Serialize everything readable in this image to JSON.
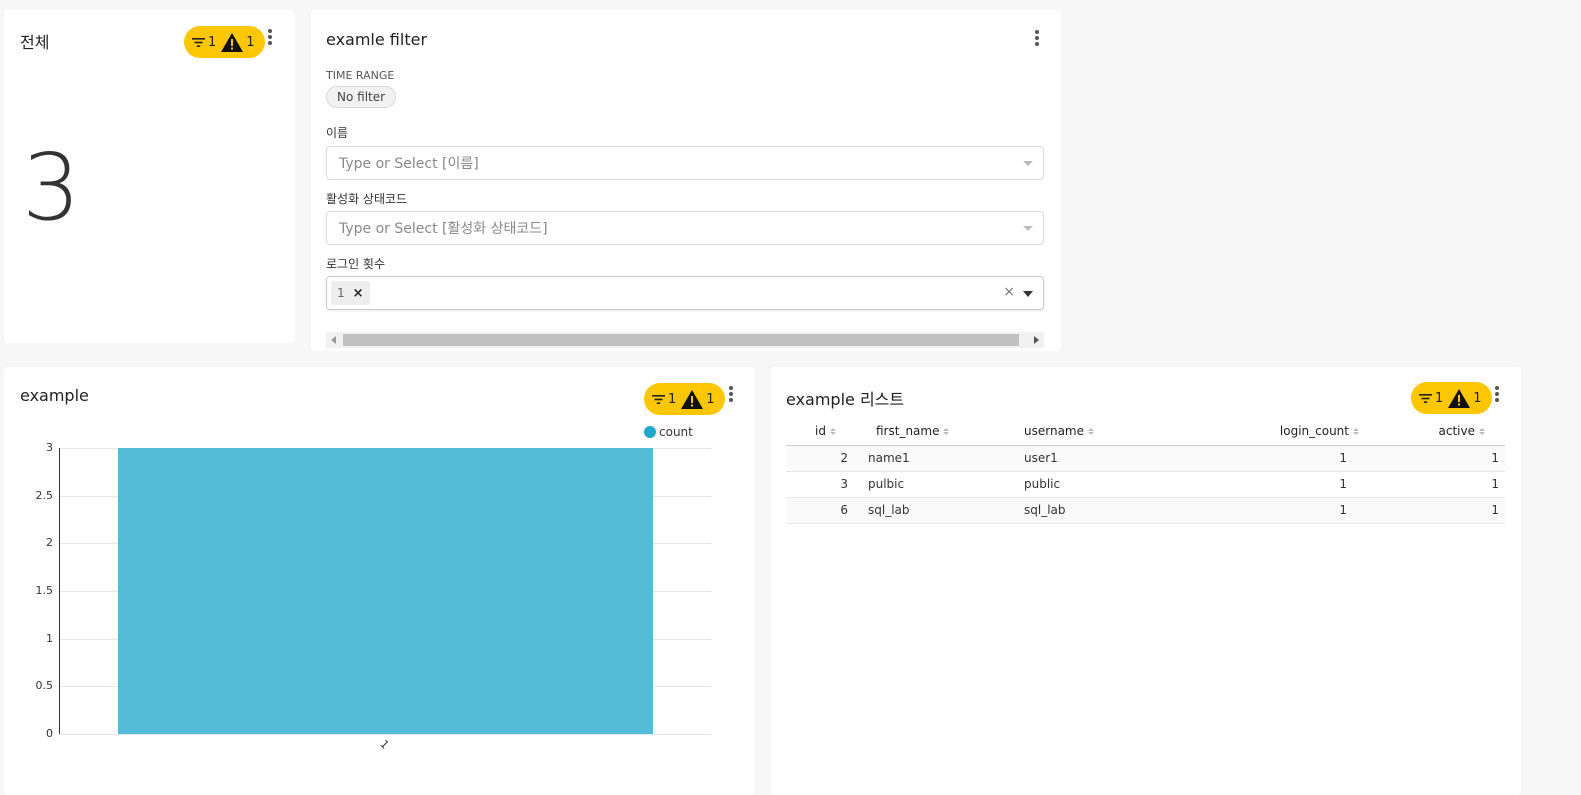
{
  "big_number": {
    "title": "전체",
    "value": "3",
    "badge_filter_count": "1",
    "badge_warning_count": "1"
  },
  "filter_panel": {
    "title": "examle filter",
    "time_range_label": "TIME RANGE",
    "time_range_value": "No filter",
    "name_label": "이름",
    "name_placeholder": "Type or Select [이름]",
    "status_label": "활성화 상태코드",
    "status_placeholder": "Type or Select [활성화 상태코드]",
    "login_label": "로그인 횟수",
    "login_tag": "1",
    "login_tag_remove": "×",
    "clear_symbol": "×"
  },
  "bar_chart": {
    "title": "example",
    "badge_filter_count": "1",
    "badge_warning_count": "1",
    "legend": "count",
    "x_tick": "1"
  },
  "chart_data": {
    "type": "bar",
    "categories": [
      "1"
    ],
    "series": [
      {
        "name": "count",
        "values": [
          3
        ],
        "color": "#4bb8d4"
      }
    ],
    "yticks": [
      "0",
      "0.5",
      "1",
      "1.5",
      "2",
      "2.5",
      "3"
    ],
    "ylim": [
      0,
      3
    ],
    "grid": true,
    "legend_position": "top-right"
  },
  "table": {
    "title": "example 리스트",
    "badge_filter_count": "1",
    "badge_warning_count": "1",
    "columns": [
      "id",
      "first_name",
      "username",
      "login_count",
      "active"
    ],
    "rows": [
      [
        "2",
        "name1",
        "user1",
        "1",
        "1"
      ],
      [
        "3",
        "pulbic",
        "public",
        "1",
        "1"
      ],
      [
        "6",
        "sql_lab",
        "sql_lab",
        "1",
        "1"
      ]
    ]
  },
  "colors": {
    "badge": "#fcc700",
    "bar": "#4bb8d4",
    "background": "#f7f7f7"
  }
}
